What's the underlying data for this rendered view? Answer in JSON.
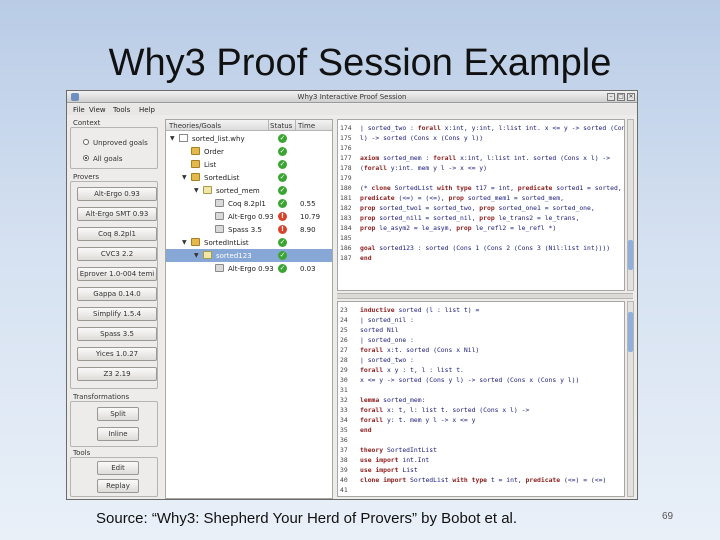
{
  "slide": {
    "title": "Why3 Proof Session Example",
    "source": "Source: “Why3: Shepherd Your Herd of Provers” by Bobot et al.",
    "page_number": "69"
  },
  "window": {
    "title": "Why3 Interactive Proof Session",
    "menu": [
      "File",
      "View",
      "Tools",
      "Help"
    ]
  },
  "context": {
    "label": "Context",
    "options": [
      {
        "label": "Unproved goals",
        "selected": false
      },
      {
        "label": "All goals",
        "selected": true
      }
    ]
  },
  "provers": {
    "label": "Provers",
    "buttons": [
      "Alt-Ergo 0.93",
      "Alt-Ergo SMT 0.93",
      "Coq 8.2pl1",
      "CVC3 2.2",
      "Eprover 1.0-004 temi",
      "Gappa 0.14.0",
      "Simplify 1.5.4",
      "Spass 3.5",
      "Yices 1.0.27",
      "Z3 2.19"
    ]
  },
  "transformations": {
    "label": "Transformations",
    "buttons": [
      "Split",
      "Inline"
    ]
  },
  "tools": {
    "label": "Tools",
    "buttons": [
      "Edit",
      "Replay"
    ]
  },
  "tree": {
    "columns": [
      "Theories/Goals",
      "Status",
      "Time"
    ],
    "rows": [
      {
        "name": "sorted_list.why",
        "status": "ok",
        "time": "",
        "kind": "file",
        "depth": 0,
        "expander": "▼"
      },
      {
        "name": "Order",
        "status": "ok",
        "time": "",
        "kind": "folder",
        "depth": 1,
        "expander": ""
      },
      {
        "name": "List",
        "status": "ok",
        "time": "",
        "kind": "folder",
        "depth": 1,
        "expander": ""
      },
      {
        "name": "SortedList",
        "status": "ok",
        "time": "",
        "kind": "folder",
        "depth": 1,
        "expander": "▼"
      },
      {
        "name": "sorted_mem",
        "status": "ok",
        "time": "",
        "kind": "goal",
        "depth": 2,
        "expander": "▼"
      },
      {
        "name": "Coq 8.2pl1",
        "status": "ok",
        "time": "0.55",
        "kind": "prover",
        "depth": 3,
        "expander": ""
      },
      {
        "name": "Alt-Ergo 0.93",
        "status": "bad",
        "time": "10.79",
        "kind": "prover",
        "depth": 3,
        "expander": ""
      },
      {
        "name": "Spass 3.5",
        "status": "bad",
        "time": "8.90",
        "kind": "prover",
        "depth": 3,
        "expander": ""
      },
      {
        "name": "SortedIntList",
        "status": "ok",
        "time": "",
        "kind": "folder",
        "depth": 1,
        "expander": "▼"
      },
      {
        "name": "sorted123",
        "status": "ok",
        "time": "",
        "kind": "goal",
        "depth": 2,
        "expander": "▼",
        "selected": true
      },
      {
        "name": "Alt-Ergo 0.93",
        "status": "ok",
        "time": "0.03",
        "kind": "prover",
        "depth": 3,
        "expander": ""
      }
    ]
  },
  "editor_top": [
    {
      "ln": "174",
      "text": "  | sorted_two : forall x:int, y:int, l:list int. x <= y -> sorted (Cons y"
    },
    {
      "ln": "175",
      "text": "      l) -> sorted (Cons x (Cons y l))"
    },
    {
      "ln": "176",
      "text": ""
    },
    {
      "ln": "177",
      "text": "  axiom sorted_mem : forall x:int, l:list int. sorted (Cons x l) ->"
    },
    {
      "ln": "178",
      "text": "    (forall y:int. mem y l -> x <= y)"
    },
    {
      "ln": "179",
      "text": ""
    },
    {
      "ln": "180",
      "text": "  (* clone SortedList with type t17 = int, predicate sorted1 = sorted,"
    },
    {
      "ln": "181",
      "text": "    predicate (<=) = (<=), prop sorted_mem1 = sorted_mem,"
    },
    {
      "ln": "182",
      "text": "    prop sorted_two1 = sorted_two, prop sorted_one1 = sorted_one,"
    },
    {
      "ln": "183",
      "text": "    prop sorted_nil1 = sorted_nil, prop le_trans2 = le_trans,"
    },
    {
      "ln": "184",
      "text": "    prop le_asym2 = le_asym, prop le_refl2 = le_refl *)"
    },
    {
      "ln": "185",
      "text": ""
    },
    {
      "ln": "186",
      "text": "  goal sorted123 : sorted (Cons 1 (Cons 2 (Cons 3 (Nil:list int))))"
    },
    {
      "ln": "187",
      "text": "end"
    }
  ],
  "editor_bottom": [
    {
      "ln": "23",
      "text": "  inductive sorted (l : list t) ="
    },
    {
      "ln": "24",
      "text": "    | sorted_nil :"
    },
    {
      "ln": "25",
      "text": "        sorted Nil"
    },
    {
      "ln": "26",
      "text": "    | sorted_one :"
    },
    {
      "ln": "27",
      "text": "        forall x:t. sorted (Cons x Nil)"
    },
    {
      "ln": "28",
      "text": "    | sorted_two :"
    },
    {
      "ln": "29",
      "text": "        forall x y : t, l : list t."
    },
    {
      "ln": "30",
      "text": "        x <= y -> sorted (Cons y l) -> sorted (Cons x (Cons y l))"
    },
    {
      "ln": "31",
      "text": ""
    },
    {
      "ln": "32",
      "text": "  lemma sorted_mem:"
    },
    {
      "ln": "33",
      "text": "    forall x: t, l: list t. sorted (Cons x l) ->"
    },
    {
      "ln": "34",
      "text": "    forall y: t. mem y l -> x <= y"
    },
    {
      "ln": "35",
      "text": "end"
    },
    {
      "ln": "36",
      "text": ""
    },
    {
      "ln": "37",
      "text": "theory SortedIntList"
    },
    {
      "ln": "38",
      "text": "  use import int.Int"
    },
    {
      "ln": "39",
      "text": "  use import List"
    },
    {
      "ln": "40",
      "text": "  clone import SortedList with type t = int, predicate (<=) = (<=)"
    },
    {
      "ln": "41",
      "text": ""
    },
    {
      "ln": "42",
      "text": "  goal sorted123: sorted (Cons 1 (Cons 2 (Cons 3 Nil)))"
    },
    {
      "ln": "43",
      "text": "end"
    }
  ],
  "colors": {
    "ok": "#3aa532",
    "bad": "#d9422a",
    "selection": "#87a8d6",
    "highlight": "#6acb3a"
  },
  "icons": {
    "ok": "✓",
    "bad": "!"
  }
}
